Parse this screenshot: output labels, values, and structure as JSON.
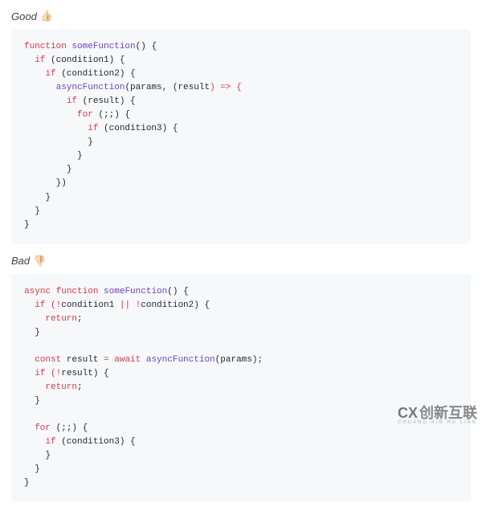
{
  "good": {
    "label": "Good",
    "emoji": "👍🏻",
    "code": {
      "l1_kw": "function",
      "l1_fn": "someFunction",
      "l1_rest": "() {",
      "l2_kw": "if",
      "l2_rest": " (condition1) {",
      "l3_kw": "if",
      "l3_rest": " (condition2) {",
      "l4_fn": "asyncFunction",
      "l4_mid": "(params, (",
      "l4_arg": "result",
      "l4_arrow": ") => {",
      "l5_kw": "if",
      "l5_rest": " (result) {",
      "l6_kw": "for",
      "l6_rest": " (;;) {",
      "l7_kw": "if",
      "l7_rest": " (condition3) {",
      "l8": "}",
      "l9": "}",
      "l10": "}",
      "l11": "})",
      "l12": "}",
      "l13": "}",
      "l14": "}"
    }
  },
  "bad": {
    "label": "Bad",
    "emoji": "👎🏻",
    "code": {
      "l1_kw1": "async",
      "l1_kw2": "function",
      "l1_fn": "someFunction",
      "l1_rest": "() {",
      "l2_kw": "if",
      "l2_op1": " (!",
      "l2_a": "condition1 ",
      "l2_op2": "||",
      "l2_op3": " !",
      "l2_b": "condition2) {",
      "l3_kw": "return",
      "l3_rest": ";",
      "l4": "}",
      "l5_kw": "const",
      "l5_name": " result ",
      "l5_eq": "=",
      "l5_await": " await",
      "l5_fn": " asyncFunction",
      "l5_rest": "(params);",
      "l6_kw": "if",
      "l6_op": " (!",
      "l6_rest": "result) {",
      "l7_kw": "return",
      "l7_rest": ";",
      "l8": "}",
      "l9_kw": "for",
      "l9_rest": " (;;) {",
      "l10_kw": "if",
      "l10_rest": " (condition3) {",
      "l11": "}",
      "l12": "}",
      "l13": "}"
    }
  },
  "watermark": {
    "brand_x": "CX",
    "brand": "创新互联",
    "sub": "CHUANG XIN HU LIAN"
  }
}
